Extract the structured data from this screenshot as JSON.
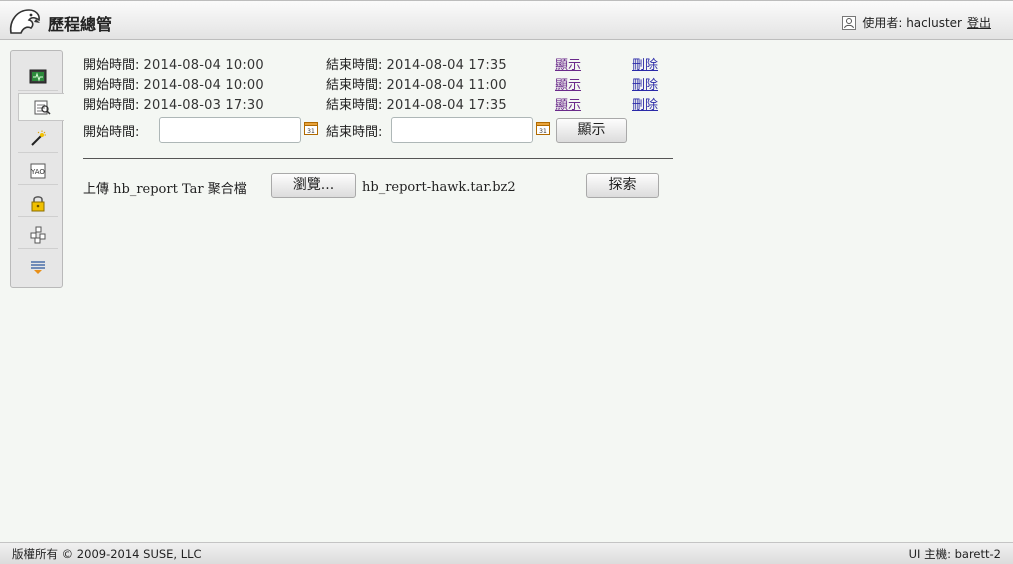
{
  "header": {
    "title": "歷程總管",
    "user_label": "使用者: hacluster",
    "logout": "登出",
    "logo_icon": "hawk-icon",
    "user_icon": "user-icon"
  },
  "sidebar": {
    "items": [
      {
        "icon": "monitor-icon"
      },
      {
        "icon": "history-explorer-icon"
      },
      {
        "icon": "wizard-icon"
      },
      {
        "icon": "config-editor-icon"
      },
      {
        "icon": "access-control-icon"
      },
      {
        "icon": "simulator-icon"
      },
      {
        "icon": "dashboard-icon"
      }
    ]
  },
  "history": {
    "rows": [
      {
        "start_label": "開始時間:",
        "start": "2014-08-04 10:00",
        "end_label": "結束時間:",
        "end": "2014-08-04 17:35",
        "show": "顯示",
        "delete": "刪除"
      },
      {
        "start_label": "開始時間:",
        "start": "2014-08-04 10:00",
        "end_label": "結束時間:",
        "end": "2014-08-04 11:00",
        "show": "顯示",
        "delete": "刪除"
      },
      {
        "start_label": "開始時間:",
        "start": "2014-08-03 17:30",
        "end_label": "結束時間:",
        "end": "2014-08-04 17:35",
        "show": "顯示",
        "delete": "刪除"
      }
    ],
    "form": {
      "start_label": "開始時間:",
      "start_value": "",
      "end_label": "結束時間:",
      "end_value": "",
      "show_button": "顯示"
    }
  },
  "upload": {
    "label": "上傳 hb_report Tar 聚合檔",
    "browse_button": "瀏覽...",
    "filename": "hb_report-hawk.tar.bz2",
    "explore_button": "探索"
  },
  "footer": {
    "copyright": "版權所有 © 2009-2014 SUSE, LLC",
    "host": "UI 主機: barett-2"
  }
}
